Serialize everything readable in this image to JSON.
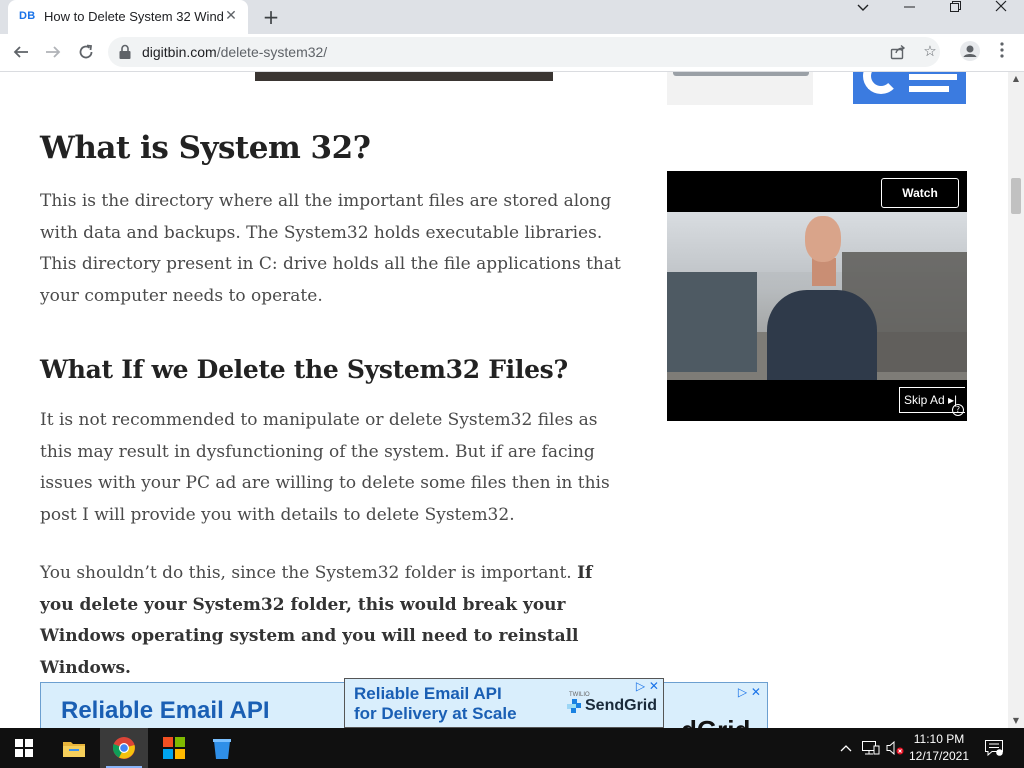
{
  "browser": {
    "tab": {
      "favicon_text": "DB",
      "title": "How to Delete System 32 Windo"
    },
    "address": {
      "host": "digitbin.com",
      "path": "/delete-system32/"
    }
  },
  "article": {
    "heading1": "What is System 32?",
    "para1": "This is the directory where all the important files are stored along with data and backups. The System32 holds executable libraries. This directory present in C: drive holds all the file applications that your computer needs to operate.",
    "heading2": "What If we Delete the System32 Files?",
    "para2": "It is not recommended to manipulate or delete System32 files as this may result in dysfunctioning of the system. But if are facing issues with your PC ad are willing to delete some files then in this post I will provide you with details to delete System32.",
    "para3_plain": "You shouldn’t do this, since the System32 folder is important. ",
    "para3_bold": "If you delete your System32 folder, this would break your Windows operating system and you will need to reinstall Windows."
  },
  "video_ad": {
    "watch_label": "Watch",
    "skip_label": "Skip Ad ▸|",
    "help": "?"
  },
  "bottom_ads": {
    "big_text": "Reliable Email API",
    "big_partial": "dGrid",
    "small_line1": "Reliable Email API",
    "small_line2": "for Delivery at Scale",
    "small_vendor": "TWILIO",
    "small_brand": "SendGrid"
  },
  "taskbar": {
    "time": "11:10 PM",
    "date": "12/17/2021"
  },
  "colors": {
    "accent": "#1a73e8",
    "ad_blue": "#1a5fb4",
    "taskbar": "#101010"
  }
}
